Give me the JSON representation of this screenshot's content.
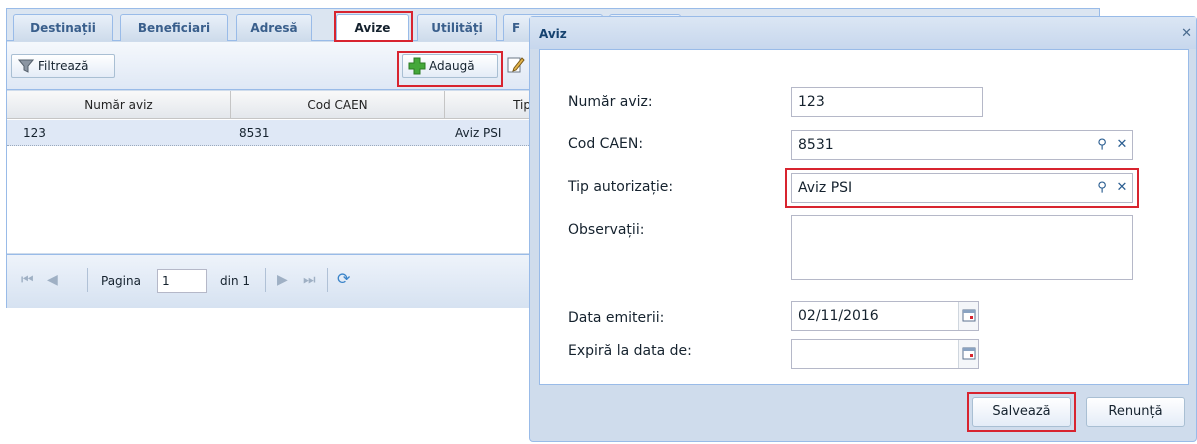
{
  "tabs": [
    {
      "label": "Destinații"
    },
    {
      "label": "Beneficiari"
    },
    {
      "label": "Adresă"
    },
    {
      "label": "Avize"
    },
    {
      "label": "Utilități"
    },
    {
      "label": "F"
    }
  ],
  "toolbar": {
    "filter_label": "Filtrează",
    "add_label": "Adaugă"
  },
  "grid": {
    "columns": [
      "Număr aviz",
      "Cod CAEN",
      "Tip"
    ],
    "rows": [
      {
        "numar": "123",
        "cod": "8531",
        "tip": "Aviz PSI"
      }
    ]
  },
  "pager": {
    "page_label": "Pagina",
    "page_value": "1",
    "of_label": "din 1"
  },
  "dialog": {
    "title": "Aviz",
    "close": "✕",
    "fields": {
      "numar_label": "Număr aviz:",
      "numar_value": "123",
      "cod_label": "Cod CAEN:",
      "cod_value": "8531",
      "tip_label": "Tip autorizație:",
      "tip_value": "Aviz PSI",
      "obs_label": "Observații:",
      "obs_value": "",
      "data_label": "Data emiterii:",
      "data_value": "02/11/2016",
      "expira_label": "Expiră la data de:",
      "expira_value": ""
    },
    "save_label": "Salvează",
    "cancel_label": "Renunță"
  },
  "colors": {
    "highlight": "#d8242f",
    "accent": "#99bbe8"
  },
  "icons": [
    "filter-icon",
    "add-icon",
    "edit-icon",
    "first-page-icon",
    "prev-page-icon",
    "next-page-icon",
    "last-page-icon",
    "refresh-icon",
    "search-icon",
    "clear-icon",
    "calendar-icon",
    "close-icon"
  ]
}
